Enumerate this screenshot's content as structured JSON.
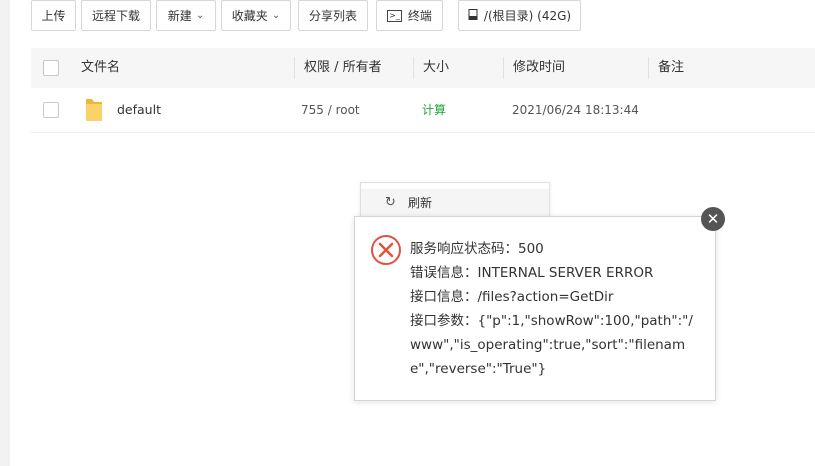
{
  "toolbar": {
    "upload": "上传",
    "remote_download": "远程下载",
    "new": "新建",
    "favorites": "收藏夹",
    "share_list": "分享列表",
    "terminal": "终端",
    "terminal_icon": ">_",
    "disk": "/(根目录) (42G)"
  },
  "table": {
    "headers": {
      "name": "文件名",
      "perm_owner": "权限 / 所有者",
      "size": "大小",
      "mtime": "修改时间",
      "note": "备注"
    },
    "rows": [
      {
        "name": "default",
        "perm_owner": "755 / root",
        "size": "计算",
        "mtime": "2021/06/24 18:13:44",
        "note": ""
      }
    ]
  },
  "context_menu": {
    "items": [
      {
        "label": "刷新",
        "icon": "refresh-icon"
      }
    ]
  },
  "error_dialog": {
    "lines": [
      "服务响应状态码：500",
      "错误信息：INTERNAL SERVER ERROR",
      "接口信息：/files?action=GetDir",
      "接口参数：{\"p\":1,\"showRow\":100,\"path\":\"/",
      "www\",\"is_operating\":true,\"sort\":\"filenam",
      "e\",\"reverse\":\"True\"}"
    ],
    "icon": "error-circle-icon",
    "close_icon": "close-icon"
  },
  "colors": {
    "accent_green": "#20a53a",
    "error_red": "#e0543f",
    "folder_yellow": "#f7c948"
  }
}
